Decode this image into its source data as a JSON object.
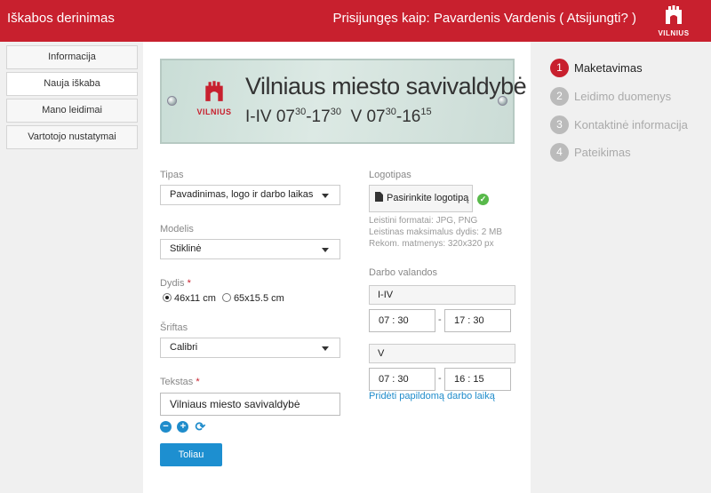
{
  "header": {
    "app_title": "Iškabos derinimas",
    "user_info": "Prisijungęs kaip: Pavardenis Vardenis ( Atsijungti? )",
    "logo_text": "VILNIUS",
    "brand_color": "#c8202e"
  },
  "sidebar": {
    "items": [
      {
        "label": "Informacija",
        "active": false
      },
      {
        "label": "Nauja iškaba",
        "active": true
      },
      {
        "label": "Mano leidimai",
        "active": false
      },
      {
        "label": "Vartotojo nustatymai",
        "active": false
      }
    ]
  },
  "preview": {
    "logo_text": "VILNIUS",
    "title": "Vilniaus miesto savivaldybė",
    "hours_1_days": "I-IV",
    "hours_1_from_h": "07",
    "hours_1_from_m": "30",
    "hours_1_to_h": "-17",
    "hours_1_to_m": "30",
    "hours_2_days": "V",
    "hours_2_from_h": "07",
    "hours_2_from_m": "30",
    "hours_2_to_h": "-16",
    "hours_2_to_m": "15"
  },
  "form": {
    "type_label": "Tipas",
    "type_value": "Pavadinimas, logo ir darbo laikas",
    "model_label": "Modelis",
    "model_value": "Stiklinė",
    "size_label": "Dydis",
    "size_options": [
      {
        "label": "46x11 cm",
        "checked": true
      },
      {
        "label": "65x15.5 cm",
        "checked": false
      }
    ],
    "font_label": "Šriftas",
    "font_value": "Calibri",
    "text_label": "Tekstas",
    "text_value": "Vilniaus miesto savivaldybė",
    "required_mark": "*",
    "icons": [
      "remove-icon",
      "add-icon",
      "refresh-icon"
    ],
    "next_button": "Toliau",
    "accent_color": "#1d8fd0"
  },
  "logo_section": {
    "label": "Logotipas",
    "upload_button": "Pasirinkite logotipą",
    "info_formats": "Leistini formatai: JPG, PNG",
    "info_size": "Leistinas maksimalus dydis: 2 MB",
    "info_dims": "Rekom. matmenys: 320x320 px"
  },
  "hours_section": {
    "label": "Darbo valandos",
    "rows": [
      {
        "days": "I-IV",
        "from": "07 : 30",
        "to": "17 : 30"
      },
      {
        "days": "V",
        "from": "07 : 30",
        "to": "16 : 15"
      }
    ],
    "separator": "-",
    "add_link": "Pridėti papildomą darbo laiką"
  },
  "steps": [
    {
      "num": "1",
      "label": "Maketavimas",
      "active": true
    },
    {
      "num": "2",
      "label": "Leidimo duomenys",
      "active": false
    },
    {
      "num": "3",
      "label": "Kontaktinė informacija",
      "active": false
    },
    {
      "num": "4",
      "label": "Pateikimas",
      "active": false
    }
  ]
}
